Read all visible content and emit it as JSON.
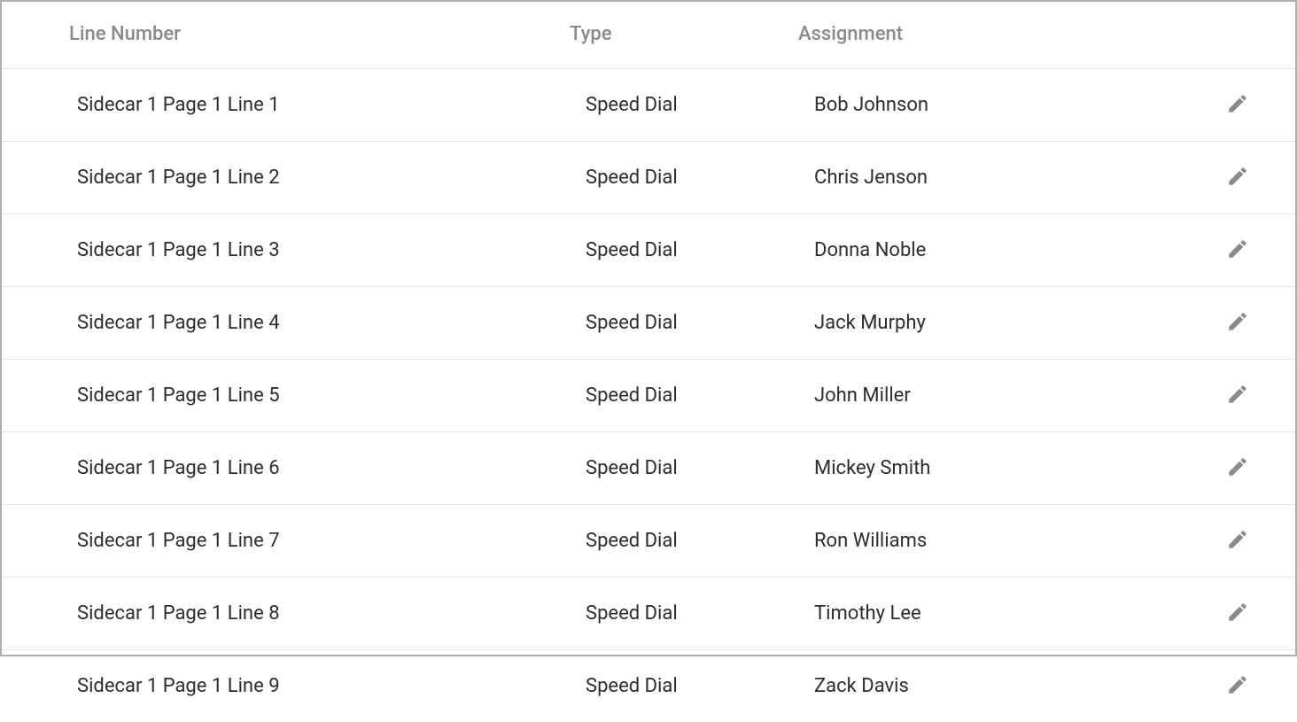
{
  "table": {
    "headers": {
      "line_number": "Line Number",
      "type": "Type",
      "assignment": "Assignment"
    },
    "rows": [
      {
        "line_number": "Sidecar 1 Page 1 Line 1",
        "type": "Speed Dial",
        "assignment": "Bob Johnson"
      },
      {
        "line_number": "Sidecar 1 Page 1 Line 2",
        "type": "Speed Dial",
        "assignment": "Chris Jenson"
      },
      {
        "line_number": "Sidecar 1 Page 1 Line 3",
        "type": "Speed Dial",
        "assignment": "Donna Noble"
      },
      {
        "line_number": "Sidecar 1 Page 1 Line 4",
        "type": "Speed Dial",
        "assignment": "Jack Murphy"
      },
      {
        "line_number": "Sidecar 1 Page 1 Line 5",
        "type": "Speed Dial",
        "assignment": "John Miller"
      },
      {
        "line_number": "Sidecar 1 Page 1 Line 6",
        "type": "Speed Dial",
        "assignment": "Mickey Smith"
      },
      {
        "line_number": "Sidecar 1 Page 1 Line 7",
        "type": "Speed Dial",
        "assignment": "Ron Williams"
      },
      {
        "line_number": "Sidecar 1 Page 1 Line 8",
        "type": "Speed Dial",
        "assignment": "Timothy Lee"
      },
      {
        "line_number": "Sidecar 1 Page 1 Line 9",
        "type": "Speed Dial",
        "assignment": "Zack Davis"
      }
    ]
  }
}
